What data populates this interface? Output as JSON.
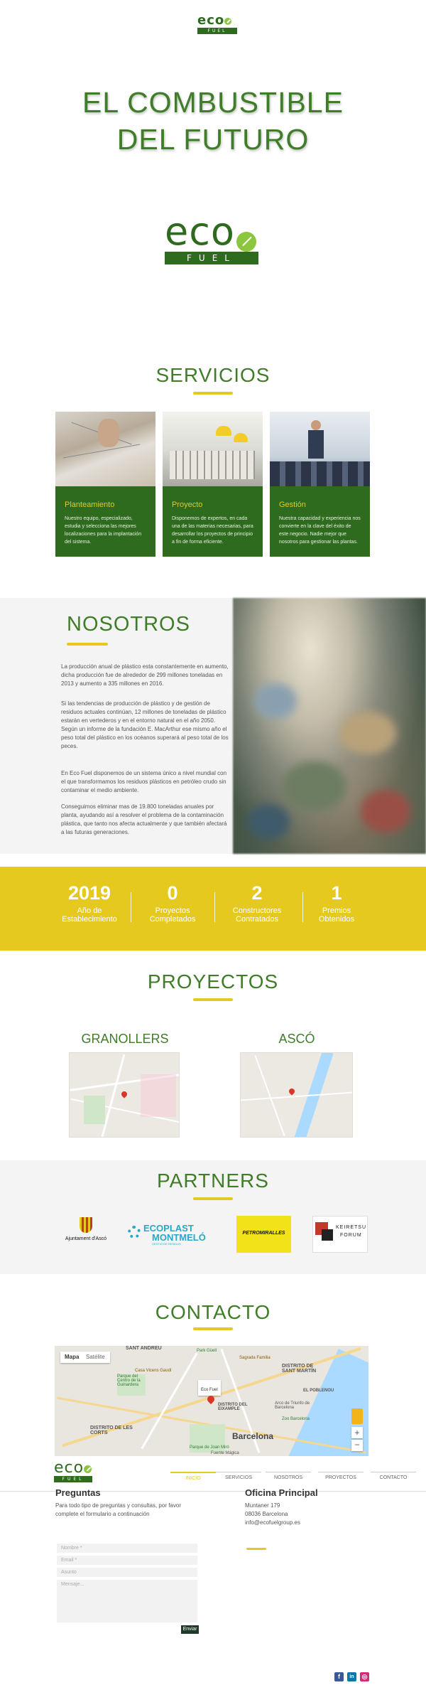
{
  "brand": {
    "logo_word": "eco",
    "logo_sub": "FUEL"
  },
  "hero": {
    "title_line1": "EL COMBUSTIBLE",
    "title_line2": "DEL FUTURO"
  },
  "servicios": {
    "title": "SERVICIOS",
    "cards": [
      {
        "title": "Planteamiento",
        "text": "Nuestro equipo, especializado, estudia y selecciona las mejores localizaciones para la implantación del sistema."
      },
      {
        "title": "Proyecto",
        "text": "Disponemos de expertos, en cada una de las materias necesarias, para desarrollar los proyectos de principio a fin de forma eficiente."
      },
      {
        "title": "Gestión",
        "text": "Nuestra capacidad y experiencia nos convierte en la clave del éxito de este negocio. Nadie mejor que nosotros para gestionar las plantas."
      }
    ]
  },
  "nosotros": {
    "title": "NOSOTROS",
    "p1": "La producción anual de plástico esta constantemente en aumento, dicha producción fue de alrededor de 299 millones toneladas en 2013 y aumento a 335 millones en 2016.",
    "p2": "Si las tendencias de producción de plástico y de gestión de residuos actuales continúan, 12 millones de toneladas de plástico estarán en vertederos y en el entorno natural en el año 2050. Según un informe de la fundación E. MacArthur ese mismo año el peso total del plástico en los océanos superará al peso total de los peces.",
    "p3": "En Eco Fuel disponemos de un sistema único a nivel mundial con el que transformamos los residuos plásticos en petróleo crudo sin contaminar el medio ambiente.",
    "p4": "Conseguimos eliminar mas de 19.800 toneladas anuales por planta, ayudando así a resolver el problema de la contaminación plástica, que tanto nos afecta actualmente y que también afectará a las futuras generaciones."
  },
  "stats": [
    {
      "num": "2019",
      "label1": "Año de",
      "label2": "Establecimiento"
    },
    {
      "num": "0",
      "label1": "Proyectos",
      "label2": "Completados"
    },
    {
      "num": "2",
      "label1": "Constructores",
      "label2": "Contratados"
    },
    {
      "num": "1",
      "label1": "Premios",
      "label2": "Obtenidos"
    }
  ],
  "proyectos": {
    "title": "PROYECTOS",
    "items": [
      {
        "name": "GRANOLLERS"
      },
      {
        "name": "ASCÓ"
      }
    ]
  },
  "partners": {
    "title": "PARTNERS",
    "logos": [
      {
        "name": "Ajuntament d'Ascó"
      },
      {
        "name": "ECOPLAST",
        "name2": "MONTMELÓ",
        "tag": "GESTIÓ DE RESIDUS"
      },
      {
        "name": "PETROMIRALLES"
      },
      {
        "name": "KEIRETSU",
        "name2": "FORUM"
      }
    ]
  },
  "contacto": {
    "title": "CONTACTO",
    "map": {
      "btn_map": "Mapa",
      "btn_sat": "Satélite",
      "labels": [
        "SANT ANDREU",
        "DISTRITO DE SANT MARTÍN",
        "Park Güell",
        "Sagrada Familia",
        "Casa Vicens Gaudí",
        "Parque del Centro de la Guinardera",
        "Eco Fuel",
        "Barcelona",
        "DISTRITO DE LES CORTS",
        "Parque de Joan Miró",
        "Zoo Barcelona",
        "Fuente Mágica",
        "Arco de Triunfo de Barcelona",
        "EL POBLENOU",
        "DISTRITO DEL EIXAMPLE"
      ]
    },
    "left_head": "Preguntas",
    "left_text": "Para todo tipo de preguntas y consultas, por favor complete el formulario a continuación",
    "right_head": "Oficina Principal",
    "address1": "Muntaner 179",
    "address2": "08036 Barcelona",
    "email": "info@ecofuelgroup.es",
    "form": {
      "name": "Nombre *",
      "email": "Email *",
      "subject": "Asunto",
      "message": "Mensaje...",
      "send": "Enviar"
    }
  },
  "nav": [
    {
      "label": "INICIO"
    },
    {
      "label": "SERVICIOS"
    },
    {
      "label": "NOSOTROS"
    },
    {
      "label": "PROYECTOS"
    },
    {
      "label": "CONTACTO"
    }
  ],
  "social": {
    "fb": "f",
    "li": "in",
    "ig": "◎"
  },
  "colors": {
    "green": "#2e6b1f",
    "title_green": "#3f7d28",
    "yellow": "#e6c91e"
  }
}
